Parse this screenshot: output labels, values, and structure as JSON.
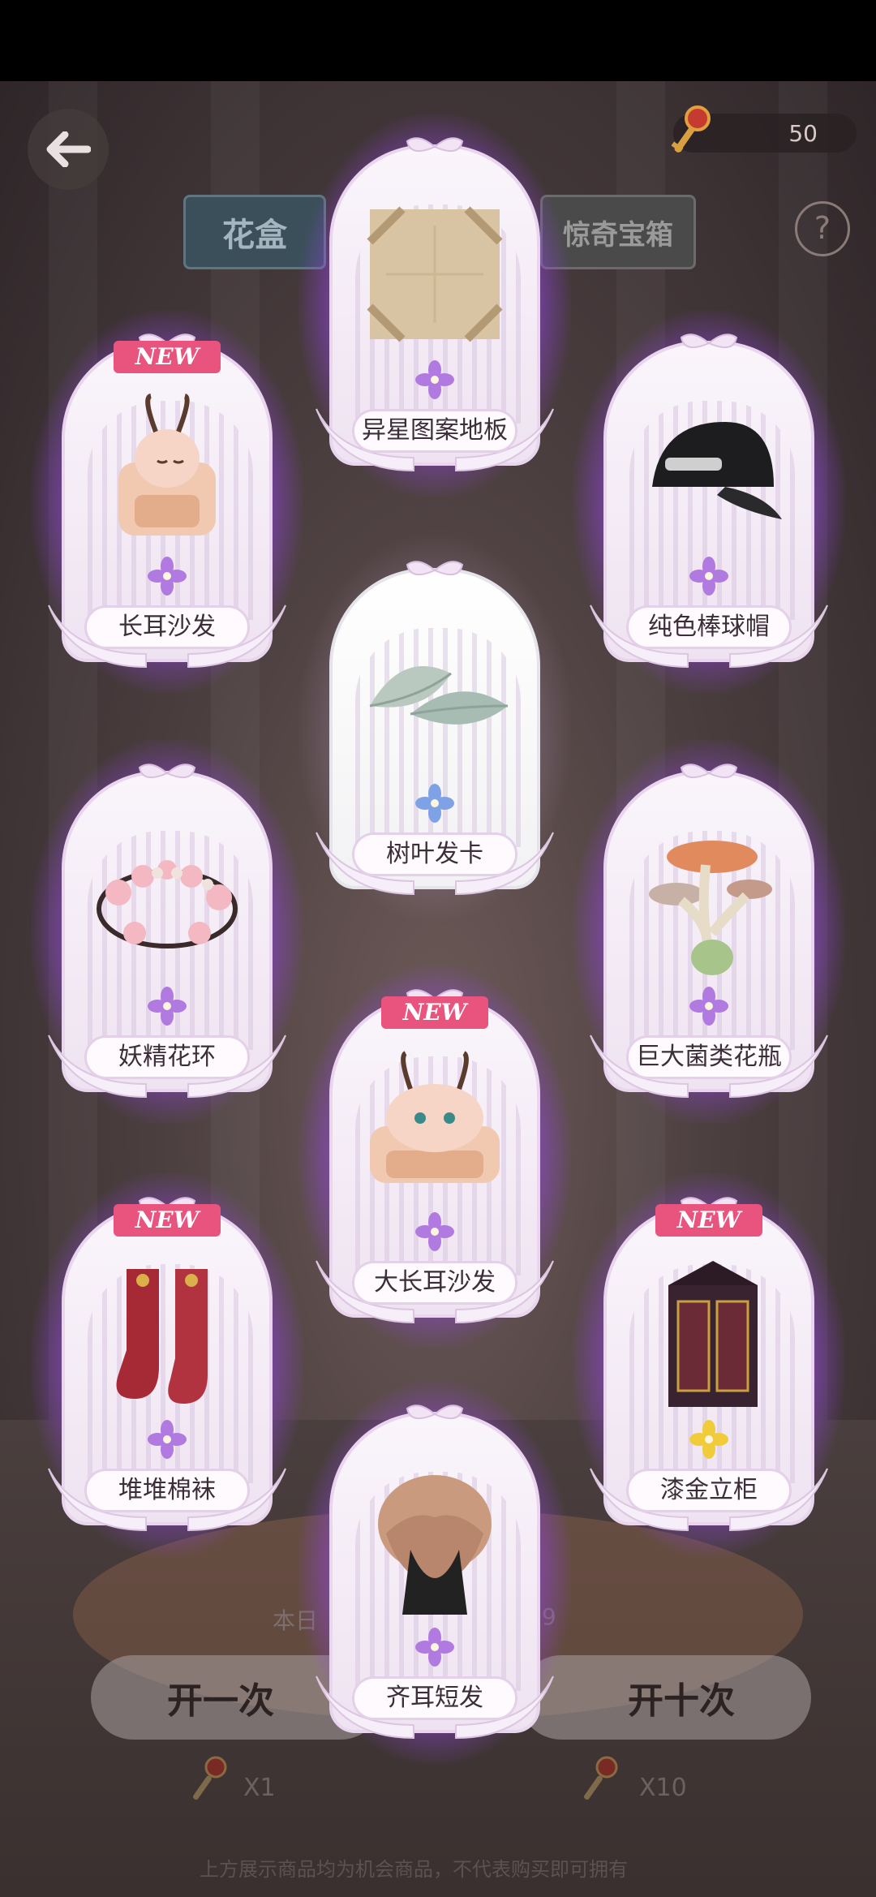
{
  "header": {
    "key_count": "50",
    "help_symbol": "?",
    "tabs": {
      "flower_box": "花盒",
      "surprise_box": "惊奇宝箱"
    }
  },
  "rewards": [
    {
      "name": "异星图案地板",
      "new": ""
    },
    {
      "name": "长耳沙发",
      "new": "NEW"
    },
    {
      "name": "纯色棒球帽",
      "new": ""
    },
    {
      "name": "树叶发卡",
      "new": ""
    },
    {
      "name": "妖精花环",
      "new": ""
    },
    {
      "name": "巨大菌类花瓶",
      "new": ""
    },
    {
      "name": "大长耳沙发",
      "new": "NEW"
    },
    {
      "name": "堆堆棉袜",
      "new": "NEW"
    },
    {
      "name": "漆金立柜",
      "new": "NEW"
    },
    {
      "name": "齐耳短发",
      "new": ""
    }
  ],
  "bottom": {
    "daily_text": "本日",
    "daily_suffix": "99",
    "open_once_label": "开一次",
    "open_ten_label": "开十次",
    "cost_once": "X1",
    "cost_ten": "X10",
    "disclaimer": "上方展示商品均为机会商品，不代表购买即可拥有"
  },
  "colors": {
    "card_glow": "#a855f7",
    "new_tag": "#e8547d",
    "flower_purple": "#b07ae0",
    "flower_blue": "#7fa2e6",
    "flower_gold": "#f0cc3a"
  }
}
